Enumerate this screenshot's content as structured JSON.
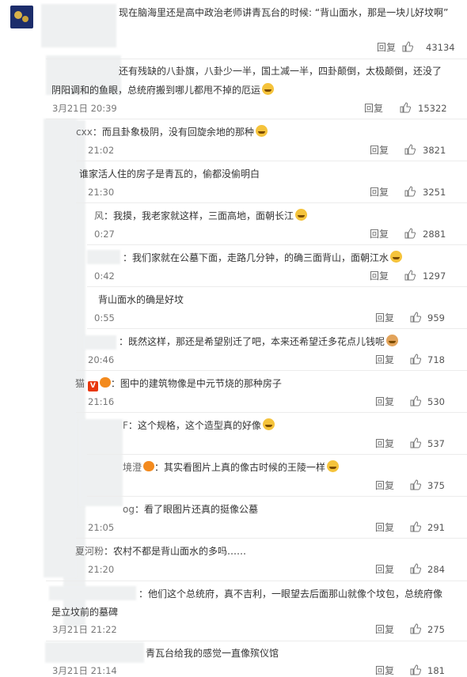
{
  "comments": [
    {
      "nick": "",
      "text": "现在脑海里还是高中政治老师讲青瓦台的时候: “背山面水，那是一块儿好坟啊”",
      "time": "",
      "reply": "回复",
      "likes": "43134"
    },
    {
      "nick": "",
      "text_line1": "还有残缺的八卦旗，八卦少一半，国土减一半，四卦颠倒，太极颠倒，还没了",
      "text_line2": "阴阳调和的鱼眼，总统府搬到哪儿都甩不掉的厄运",
      "time": "3月21日 20:39",
      "reply": "回复",
      "likes": "15322"
    },
    {
      "nick": "cxx",
      "text": "：而且卦象极阴，没有回旋余地的那种",
      "time": "21:02",
      "reply": "回复",
      "likes": "3821"
    },
    {
      "nick": "",
      "text": "谁家活人住的房子是青瓦的，偷都没偷明白",
      "time": "21:30",
      "reply": "回复",
      "likes": "3251"
    },
    {
      "nick": "风",
      "text": "：我摸，我老家就这样，三面高地，面朝长江",
      "time": "0:27",
      "reply": "回复",
      "likes": "2881"
    },
    {
      "nick": "",
      "text": "：我们家就在公墓下面，走路几分钟，的确三面背山，面朝江水",
      "time": "0:42",
      "reply": "回复",
      "likes": "1297"
    },
    {
      "nick": "",
      "text": "背山面水的确是好坟",
      "time": "0:55",
      "reply": "回复",
      "likes": "959"
    },
    {
      "nick": "",
      "text": "：既然这样，那还是希望别迁了吧，本来还希望迁多花点儿钱呢",
      "time": "20:46",
      "reply": "回复",
      "likes": "718"
    },
    {
      "nick": "猫",
      "text": "：图中的建筑物像是中元节烧的那种房子",
      "time": "21:16",
      "reply": "回复",
      "likes": "530"
    },
    {
      "nick": "F",
      "text": "：这个规格，这个造型真的好像",
      "time": "",
      "reply": "回复",
      "likes": "537"
    },
    {
      "nick": "境澄",
      "text": "：其实看图片上真的像古时候的王陵一样",
      "time": "",
      "reply": "回复",
      "likes": "375"
    },
    {
      "nick": "og",
      "text": "：看了眼图片还真的挺像公墓",
      "time": "21:05",
      "reply": "回复",
      "likes": "291"
    },
    {
      "nick": "夏河粉",
      "text": "：农村不都是背山面水的多吗……",
      "time": "21:20",
      "reply": "回复",
      "likes": "284"
    },
    {
      "nick": "",
      "text_line1": "：他们这个总统府，真不吉利，一眼望去后面那山就像个坟包，总统府像",
      "text_line2": "是立坟前的墓碑",
      "time": "3月21日 21:22",
      "reply": "回复",
      "likes": "275"
    },
    {
      "nick": "",
      "text": "青瓦台给我的感觉一直像殡仪馆",
      "time": "3月21日 21:14",
      "reply": "回复",
      "likes": "181"
    }
  ],
  "badges": {
    "v": "V"
  },
  "icons": {
    "like": "thumbs-up-icon",
    "emoji": "laughing-emoji-icon"
  },
  "colors": {
    "text": "#333333",
    "muted": "#777777",
    "divider": "#ececec",
    "accent": "#f5c33b"
  }
}
